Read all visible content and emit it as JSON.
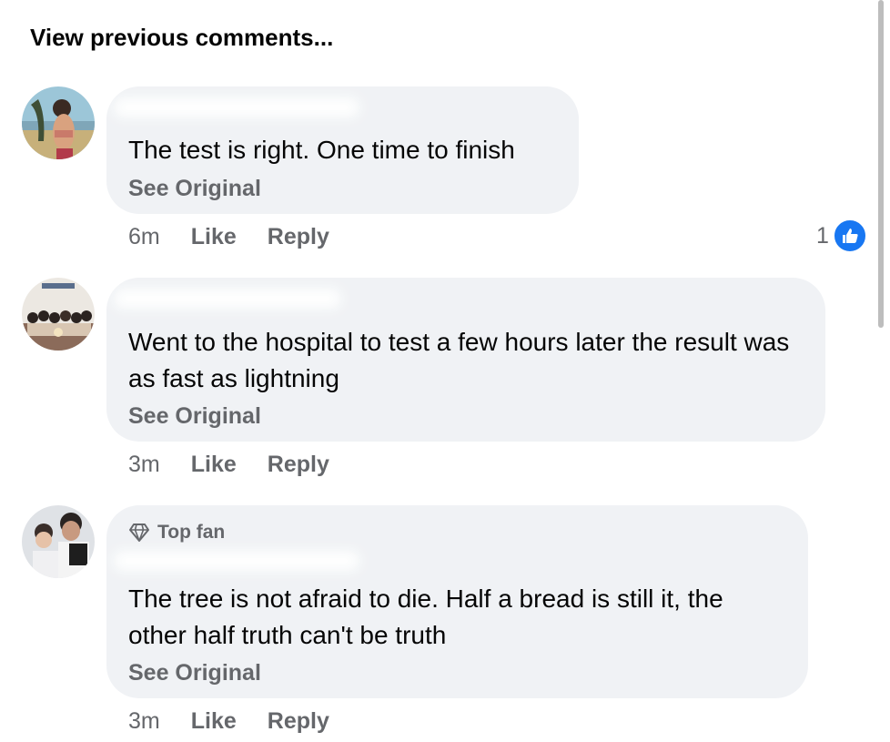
{
  "header": {
    "view_previous": "View previous comments..."
  },
  "comments": [
    {
      "text": "The test is right. One time to finish",
      "see_original": "See Original",
      "time": "6m",
      "like": "Like",
      "reply": "Reply",
      "reaction_count": "1"
    },
    {
      "text": "Went to the hospital to test a few hours later the result was as fast as lightning",
      "see_original": "See Original",
      "time": "3m",
      "like": "Like",
      "reply": "Reply"
    },
    {
      "badge": "Top fan",
      "text": "The tree is not afraid to die. Half a bread is still it, the other half truth can't be truth",
      "see_original": "See Original",
      "time": "3m",
      "like": "Like",
      "reply": "Reply"
    }
  ],
  "colors": {
    "bubble": "#f0f2f5",
    "secondary_text": "#65676b",
    "like_blue": "#1877f2"
  },
  "icons": {
    "reaction": "thumbs-up-icon",
    "badge": "diamond-icon"
  }
}
